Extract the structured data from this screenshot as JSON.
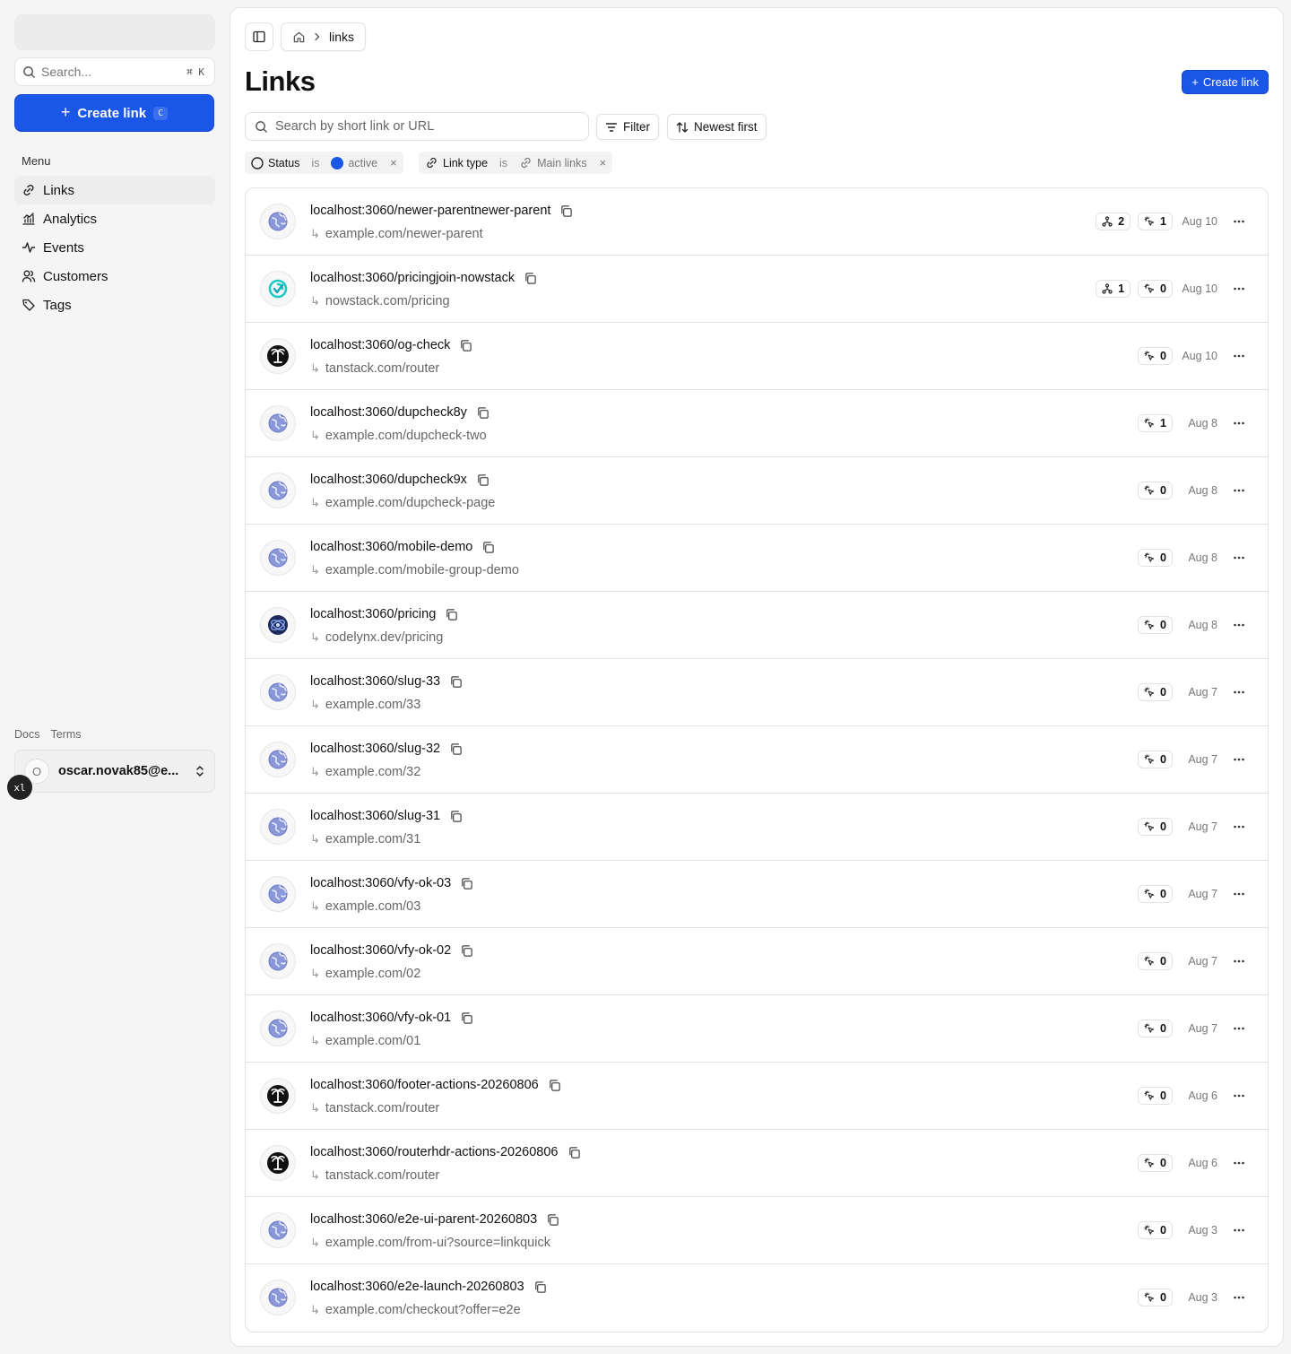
{
  "sidebar": {
    "search_placeholder": "Search...",
    "search_shortcut": "⌘ K",
    "create_label": "Create link",
    "create_shortcut": "C",
    "menu_title": "Menu",
    "items": [
      {
        "label": "Links",
        "icon": "link-icon",
        "active": true
      },
      {
        "label": "Analytics",
        "icon": "chart-icon",
        "active": false
      },
      {
        "label": "Events",
        "icon": "activity-icon",
        "active": false
      },
      {
        "label": "Customers",
        "icon": "users-icon",
        "active": false
      },
      {
        "label": "Tags",
        "icon": "tag-icon",
        "active": false
      }
    ],
    "footer_links": [
      "Docs",
      "Terms"
    ],
    "user": {
      "initial": "O",
      "email": "oscar.novak85@e..."
    },
    "env_badge": "xl"
  },
  "header": {
    "breadcrumb_current": "links",
    "title": "Links",
    "create_label": "Create link"
  },
  "toolbar": {
    "search_placeholder": "Search by short link or URL",
    "filter_label": "Filter",
    "sort_label": "Newest first"
  },
  "filters": [
    {
      "field": "Status",
      "op": "is",
      "value": "active",
      "color": "#1a56e8"
    },
    {
      "field": "Link type",
      "op": "is",
      "value": "Main links"
    }
  ],
  "links": [
    {
      "short": "localhost:3060/newer-parentnewer-parent",
      "dest": "example.com/newer-parent",
      "icon": "globe",
      "children": "2",
      "clicks": "1",
      "date": "Aug 10"
    },
    {
      "short": "localhost:3060/pricingjoin-nowstack",
      "dest": "nowstack.com/pricing",
      "icon": "nowstack",
      "children": "1",
      "clicks": "0",
      "date": "Aug 10"
    },
    {
      "short": "localhost:3060/og-check",
      "dest": "tanstack.com/router",
      "icon": "tanstack",
      "children": null,
      "clicks": "0",
      "date": "Aug 10"
    },
    {
      "short": "localhost:3060/dupcheck8y",
      "dest": "example.com/dupcheck-two",
      "icon": "globe",
      "children": null,
      "clicks": "1",
      "date": "Aug 8"
    },
    {
      "short": "localhost:3060/dupcheck9x",
      "dest": "example.com/dupcheck-page",
      "icon": "globe",
      "children": null,
      "clicks": "0",
      "date": "Aug 8"
    },
    {
      "short": "localhost:3060/mobile-demo",
      "dest": "example.com/mobile-group-demo",
      "icon": "globe",
      "children": null,
      "clicks": "0",
      "date": "Aug 8"
    },
    {
      "short": "localhost:3060/pricing",
      "dest": "codelynx.dev/pricing",
      "icon": "codelynx",
      "children": null,
      "clicks": "0",
      "date": "Aug 8"
    },
    {
      "short": "localhost:3060/slug-33",
      "dest": "example.com/33",
      "icon": "globe",
      "children": null,
      "clicks": "0",
      "date": "Aug 7"
    },
    {
      "short": "localhost:3060/slug-32",
      "dest": "example.com/32",
      "icon": "globe",
      "children": null,
      "clicks": "0",
      "date": "Aug 7"
    },
    {
      "short": "localhost:3060/slug-31",
      "dest": "example.com/31",
      "icon": "globe",
      "children": null,
      "clicks": "0",
      "date": "Aug 7"
    },
    {
      "short": "localhost:3060/vfy-ok-03",
      "dest": "example.com/03",
      "icon": "globe",
      "children": null,
      "clicks": "0",
      "date": "Aug 7"
    },
    {
      "short": "localhost:3060/vfy-ok-02",
      "dest": "example.com/02",
      "icon": "globe",
      "children": null,
      "clicks": "0",
      "date": "Aug 7"
    },
    {
      "short": "localhost:3060/vfy-ok-01",
      "dest": "example.com/01",
      "icon": "globe",
      "children": null,
      "clicks": "0",
      "date": "Aug 7"
    },
    {
      "short": "localhost:3060/footer-actions-20260806",
      "dest": "tanstack.com/router",
      "icon": "tanstack",
      "children": null,
      "clicks": "0",
      "date": "Aug 6"
    },
    {
      "short": "localhost:3060/routerhdr-actions-20260806",
      "dest": "tanstack.com/router",
      "icon": "tanstack",
      "children": null,
      "clicks": "0",
      "date": "Aug 6"
    },
    {
      "short": "localhost:3060/e2e-ui-parent-20260803",
      "dest": "example.com/from-ui?source=linkquick",
      "icon": "globe",
      "children": null,
      "clicks": "0",
      "date": "Aug 3"
    },
    {
      "short": "localhost:3060/e2e-launch-20260803",
      "dest": "example.com/checkout?offer=e2e",
      "icon": "globe",
      "children": null,
      "clicks": "0",
      "date": "Aug 3"
    }
  ]
}
